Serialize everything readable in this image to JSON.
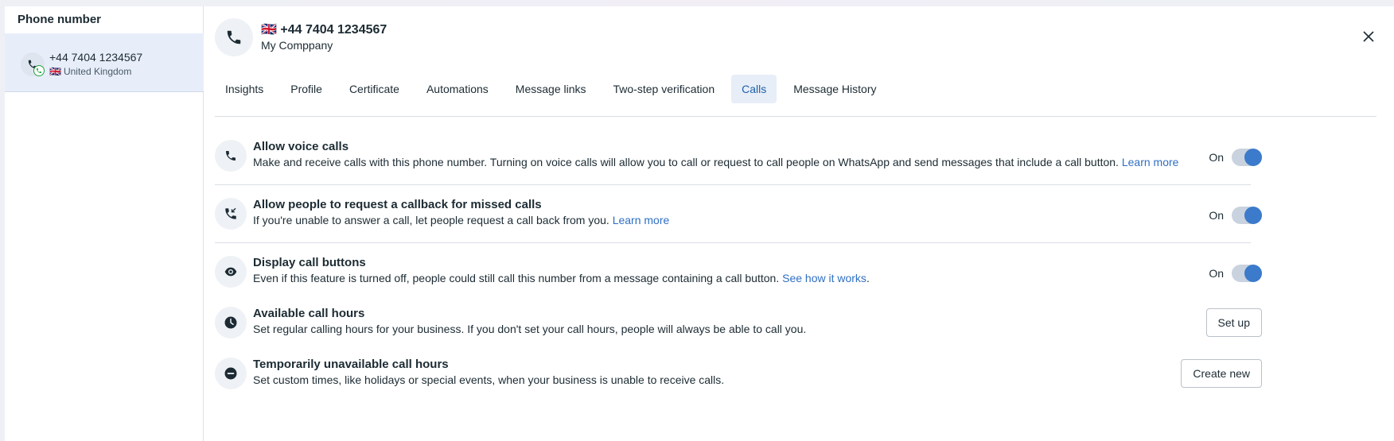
{
  "sidebar": {
    "title": "Phone number",
    "items": [
      {
        "number": "+44 7404 1234567",
        "flag": "🇬🇧",
        "country": "United Kingdom"
      }
    ]
  },
  "header": {
    "flag": "🇬🇧",
    "number": "+44 7404 1234567",
    "company": "My Comppany"
  },
  "tabs": [
    {
      "label": "Insights",
      "active": false
    },
    {
      "label": "Profile",
      "active": false
    },
    {
      "label": "Certificate",
      "active": false
    },
    {
      "label": "Automations",
      "active": false
    },
    {
      "label": "Message links",
      "active": false
    },
    {
      "label": "Two-step verification",
      "active": false
    },
    {
      "label": "Calls",
      "active": true
    },
    {
      "label": "Message History",
      "active": false
    }
  ],
  "settings": {
    "voice_calls": {
      "title": "Allow voice calls",
      "description": "Make and receive calls with this phone number. Turning on voice calls will allow you to call or request to call people on WhatsApp and send messages that include a call button.",
      "link": "Learn more",
      "toggle_label": "On",
      "enabled": true,
      "icon": "phone-icon"
    },
    "callback": {
      "title": "Allow people to request a callback for missed calls",
      "description": "If you're unable to answer a call, let people request a call back from you.",
      "link": "Learn more",
      "toggle_label": "On",
      "enabled": true,
      "icon": "missed-call-icon"
    },
    "call_buttons": {
      "title": "Display call buttons",
      "description": "Even if this feature is turned off, people could still call this number from a message containing a call button.",
      "link": "See how it works",
      "suffix": ".",
      "toggle_label": "On",
      "enabled": true,
      "icon": "eye-icon"
    },
    "call_hours": {
      "title": "Available call hours",
      "description": "Set regular calling hours for your business. If you don't set your call hours, people will always be able to call you.",
      "button": "Set up",
      "icon": "clock-icon"
    },
    "unavailable_hours": {
      "title": "Temporarily unavailable call hours",
      "description": "Set custom times, like holidays or special events, when your business is unable to receive calls.",
      "button": "Create new",
      "icon": "minus-circle-icon"
    }
  },
  "colors": {
    "accent": "#3c7acb",
    "link": "#2f6fc2",
    "active_tab_bg": "#e7eef8",
    "selected_item_bg": "#e8eef9"
  }
}
